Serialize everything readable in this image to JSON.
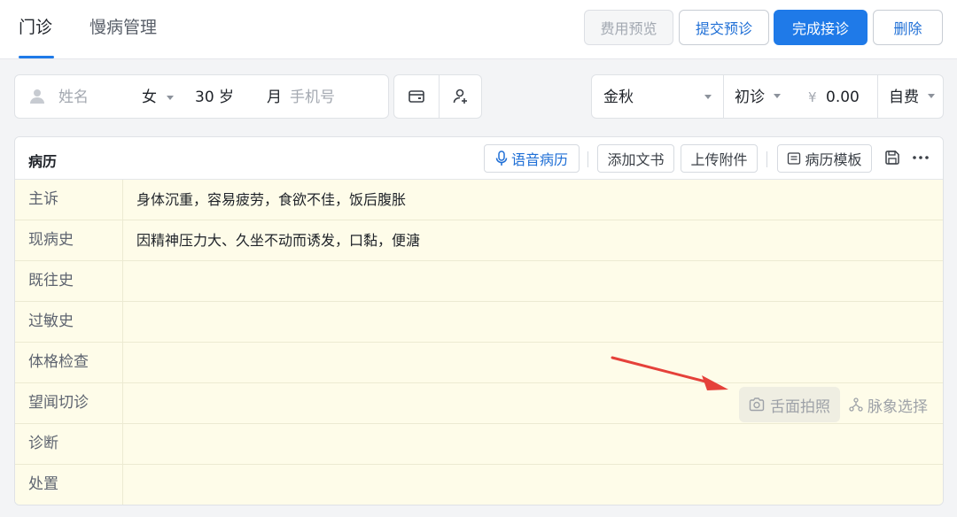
{
  "tabs": [
    {
      "label": "门诊",
      "active": true
    },
    {
      "label": "慢病管理",
      "active": false
    }
  ],
  "toolbar": {
    "fee_preview": "费用预览",
    "submit_preconsult": "提交预诊",
    "complete": "完成接诊",
    "delete": "删除"
  },
  "patient": {
    "name_placeholder": "姓名",
    "gender": "女",
    "age_value": "30",
    "age_unit": "岁",
    "month_unit": "月",
    "phone_placeholder": "手机号"
  },
  "visit": {
    "doctor": "金秋",
    "visit_type": "初诊",
    "currency": "¥",
    "amount": "0.00",
    "payment": "自费"
  },
  "record": {
    "title": "病历",
    "voice": "语音病历",
    "add_doc": "添加文书",
    "upload": "上传附件",
    "template": "病历模板",
    "rows": [
      {
        "label": "主诉",
        "value": "身体沉重，容易疲劳，食欲不佳，饭后腹胀"
      },
      {
        "label": "现病史",
        "value": "因精神压力大、久坐不动而诱发，口黏，便溏"
      },
      {
        "label": "既往史",
        "value": ""
      },
      {
        "label": "过敏史",
        "value": ""
      },
      {
        "label": "体格检查",
        "value": ""
      },
      {
        "label": "望闻切诊",
        "value": ""
      },
      {
        "label": "诊断",
        "value": ""
      },
      {
        "label": "处置",
        "value": ""
      }
    ],
    "tongue_photo": "舌面拍照",
    "pulse_select": "脉象选择"
  },
  "colors": {
    "accent": "#1f7ae8",
    "row_bg": "#fefce9",
    "arrow": "#e5413a"
  }
}
